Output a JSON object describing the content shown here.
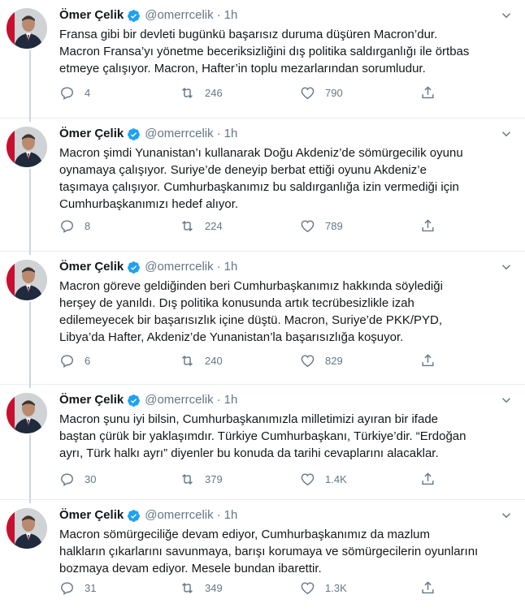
{
  "colors": {
    "text": "#14171a",
    "secondary": "#657786",
    "verified": "#1da1f2",
    "divider": "#e6ecf0",
    "thread_line": "#ccd6dd"
  },
  "tweets": [
    {
      "name": "Ömer Çelik",
      "handle": "@omerrcelik",
      "separator": "·",
      "time": "1h",
      "text": "Fransa gibi bir devleti bugünkü başarısız duruma düşüren Macron’dur.\nMacron Fransa’yı yönetme beceriksizliğini dış politika saldırganlığı ile örtbas\netmeye çalışıyor. Macron, Hafter’in toplu mezarlarından sorumludur.",
      "replies": "4",
      "retweets": "246",
      "likes": "790"
    },
    {
      "name": "Ömer Çelik",
      "handle": "@omerrcelik",
      "separator": "·",
      "time": "1h",
      "text": "Macron şimdi Yunanistan’ı kullanarak Doğu Akdeniz’de sömürgecilik oyunu\noynamaya çalışıyor. Suriye’de deneyip berbat ettiği oyunu Akdeniz’e\ntaşımaya çalışıyor. Cumhurbaşkanımız bu saldırganlığa izin vermediği için\nCumhurbaşkanımızı hedef alıyor.",
      "replies": "8",
      "retweets": "224",
      "likes": "789"
    },
    {
      "name": "Ömer Çelik",
      "handle": "@omerrcelik",
      "separator": "·",
      "time": "1h",
      "text": "Macron göreve geldiğinden beri Cumhurbaşkanımız hakkında söylediği\nherşey de yanıldı. Dış politika konusunda artık tecrübesizlikle izah\nedilemeyecek bir başarısızlık içine düştü. Macron, Suriye’de PKK/PYD,\nLibya’da Hafter, Akdeniz’de Yunanistan’la başarısızlığa koşuyor.",
      "replies": "6",
      "retweets": "240",
      "likes": "829"
    },
    {
      "name": "Ömer Çelik",
      "handle": "@omerrcelik",
      "separator": "·",
      "time": "1h",
      "text": "Macron şunu iyi bilsin, Cumhurbaşkanımızla milletimizi ayıran bir ifade\nbaştan çürük bir yaklaşımdır. Türkiye Cumhurbaşkanı, Türkiye’dir.  “Erdoğan\nayrı, Türk halkı ayrı” diyenler bu konuda da tarihi cevaplarını alacaklar.",
      "replies": "30",
      "retweets": "379",
      "likes": "1.4K"
    },
    {
      "name": "Ömer Çelik",
      "handle": "@omerrcelik",
      "separator": "·",
      "time": "1h",
      "text": "Macron sömürgeciliğe devam ediyor, Cumhurbaşkanımız da mazlum\nhalkların çıkarlarını savunmaya, barışı korumaya ve sömürgecilerin oyunlarını\nbozmaya devam ediyor. Mesele bundan ibarettir.",
      "replies": "31",
      "retweets": "349",
      "likes": "1.3K"
    }
  ]
}
